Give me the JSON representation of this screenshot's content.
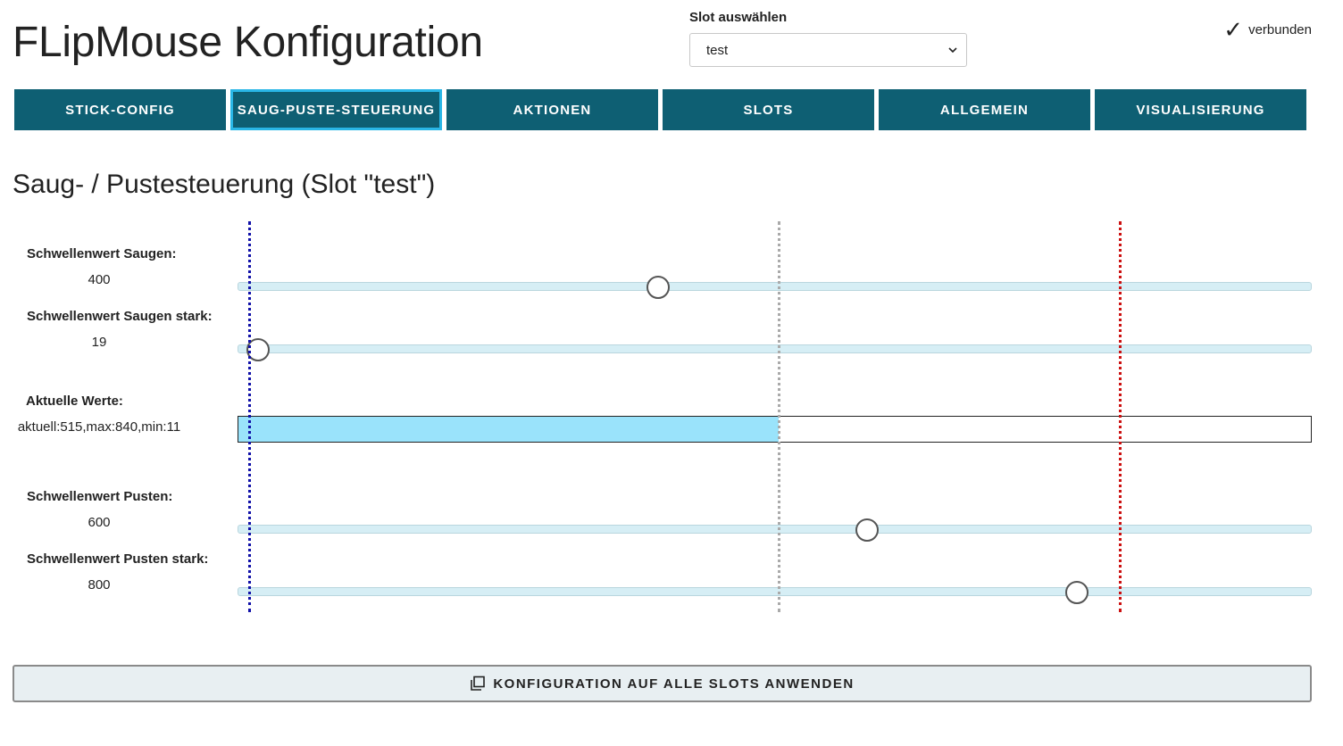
{
  "header": {
    "title": "FLipMouse Konfiguration",
    "slot_select_label": "Slot auswählen",
    "slot_selected": "test",
    "connection_status": "verbunden"
  },
  "tabs": [
    {
      "label": "STICK-CONFIG",
      "active": false
    },
    {
      "label": "SAUG-PUSTE-STEUERUNG",
      "active": true
    },
    {
      "label": "AKTIONEN",
      "active": false
    },
    {
      "label": "SLOTS",
      "active": false
    },
    {
      "label": "ALLGEMEIN",
      "active": false
    },
    {
      "label": "VISUALISIERUNG",
      "active": false
    }
  ],
  "section_title": "Saug- / Pustesteuerung (Slot \"test\")",
  "sensor_range": {
    "min": 0,
    "max": 1023
  },
  "sliders": [
    {
      "label": "Schwellenwert Saugen:",
      "value": "400",
      "numeric": 400
    },
    {
      "label": "Schwellenwert Saugen stark:",
      "value": "19",
      "numeric": 19
    },
    {
      "label": "Schwellenwert Pusten:",
      "value": "600",
      "numeric": 600
    },
    {
      "label": "Schwellenwert Pusten stark:",
      "value": "800",
      "numeric": 800
    }
  ],
  "current_values": {
    "label": "Aktuelle Werte:",
    "text": "aktuell:515,max:840,min:11",
    "current": 515,
    "max": 840,
    "min": 11
  },
  "apply_button": "KONFIGURATION AUF ALLE SLOTS ANWENDEN",
  "colors": {
    "tab_bg": "#0e5f73",
    "tab_active_border": "#29b6e6",
    "bar_fill": "#9ae3fb",
    "min_marker": "#1010a8",
    "current_marker": "#aaaaaa",
    "max_marker": "#cc1010"
  }
}
